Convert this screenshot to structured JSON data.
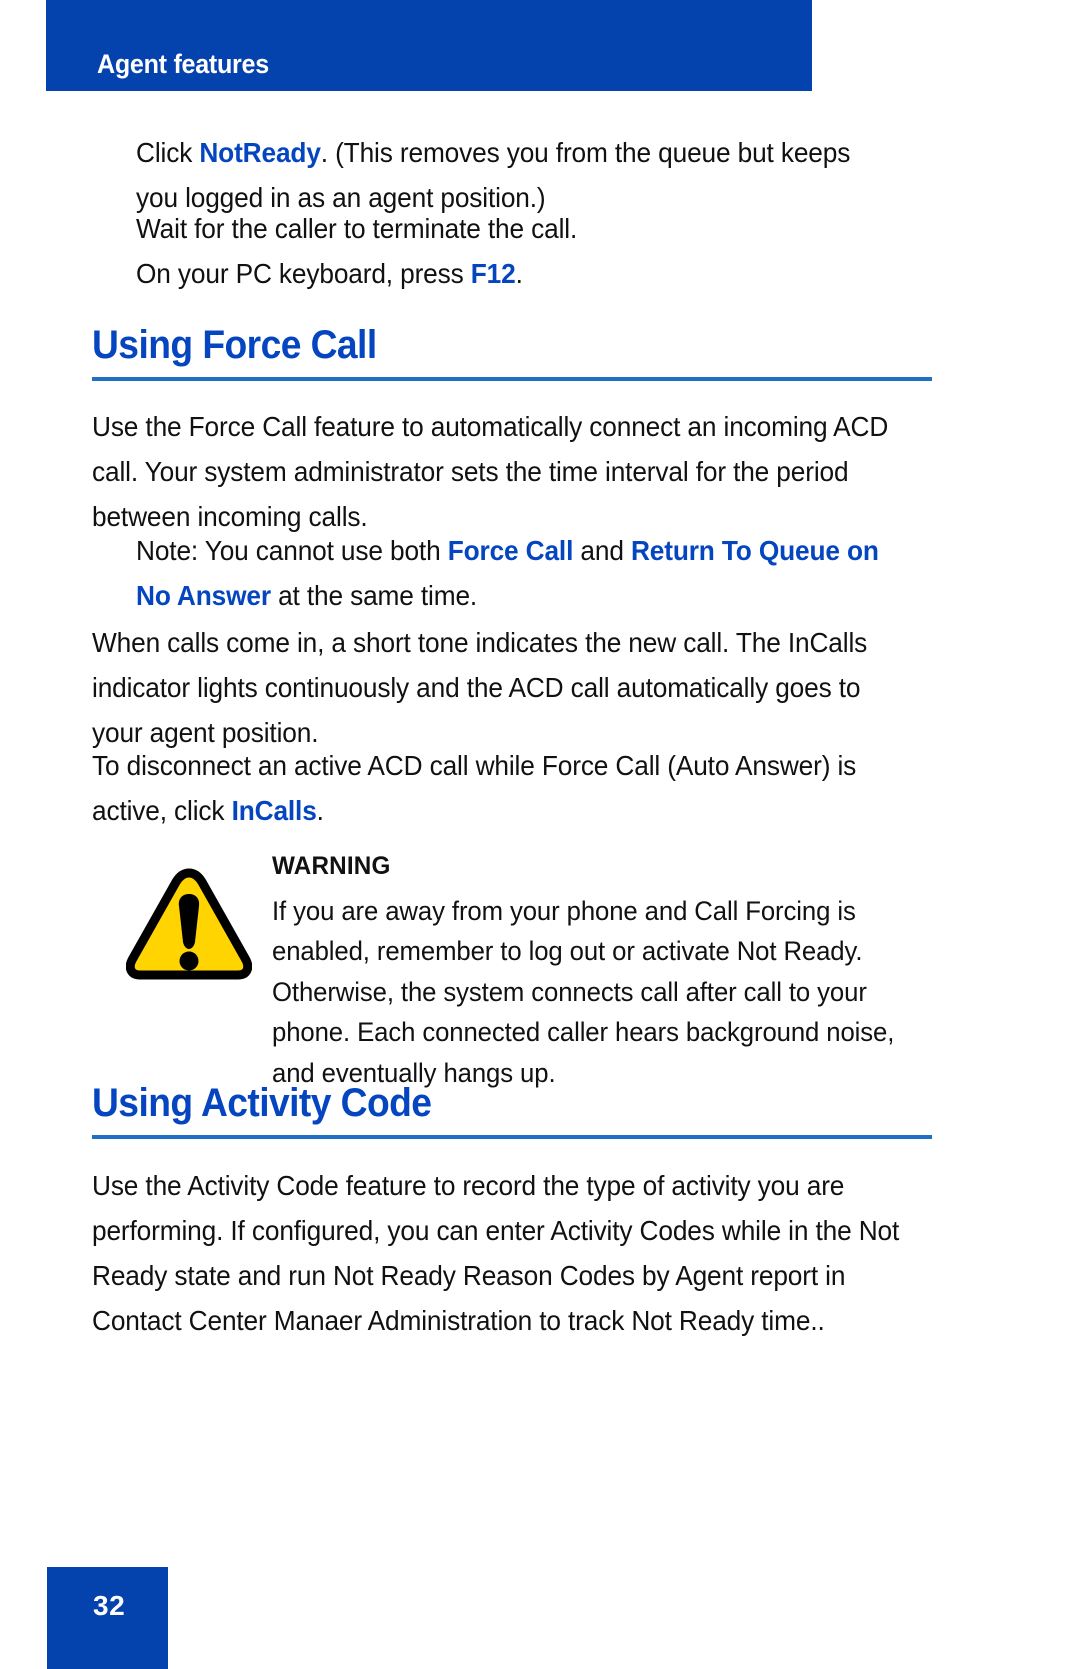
{
  "page": {
    "running_header": "Agent features",
    "page_number": "32",
    "accent_blue": "#0442AE",
    "link_blue": "#0546C0",
    "rule_blue": "#1F6FC4",
    "warning_yellow": "#FFD400"
  },
  "steps": [
    {
      "id": "step-notready",
      "prefix": "Click ",
      "term": "NotReady",
      "suffix": ". (This removes you from the queue but keeps you logged in as an agent position.)"
    },
    {
      "id": "step-wait",
      "prefix": "Wait for the caller to terminate the call",
      "term": "",
      "suffix": "."
    },
    {
      "id": "step-f12",
      "prefix": "On your PC keyboard, press ",
      "term": "F12",
      "suffix": "."
    }
  ],
  "sections": [
    {
      "id": "force-call",
      "title": "Using Force Call",
      "intro": "Use the Force Call feature to automatically connect an incoming ACD call. Your system administrator sets the time interval for the period between incoming calls.",
      "note": {
        "label": "Note:",
        "text_1": " You cannot use both ",
        "term_1": "Force Call",
        "text_2": " and ",
        "term_2": "Return To Queue on No Answer",
        "text_3": " at the same time."
      },
      "body_1": "When calls come in, a short tone indicates the new call. The InCalls indicator lights continuously and the ACD call automatically goes to your agent position.",
      "body_2_prefix": "To disconnect an active ACD call while Force Call (Auto Answer) is active, click ",
      "body_2_term": "InCalls",
      "body_2_suffix": "."
    },
    {
      "id": "activity-code",
      "title": "Using Activity Code",
      "intro": "Use the Activity Code feature to record the type of activity you are performing. If configured, you can enter Activity Codes while in the Not Ready state and run Not Ready Reason Codes by Agent report in Contact Center Manaer Administration to track Not Ready time.."
    }
  ],
  "warning": {
    "label": "WARNING",
    "text": "If you are away from your phone and Call Forcing is enabled, remember to log out or activate Not Ready. Otherwise, the system connects call after call to your phone.  Each connected caller hears background noise, and eventually hangs up.",
    "icon": "warning-triangle-icon"
  }
}
